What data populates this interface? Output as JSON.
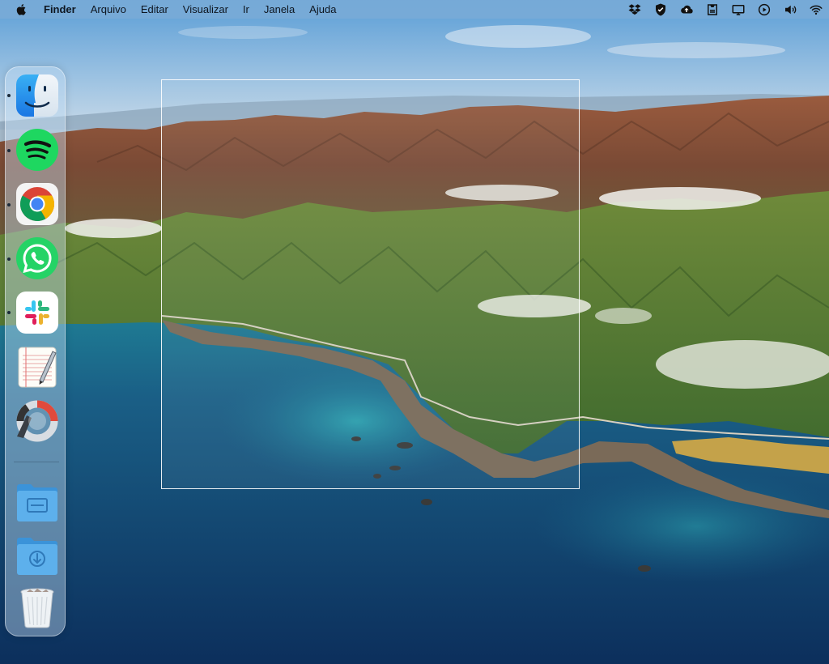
{
  "menubar": {
    "apple_menu_icon": "apple-logo-icon",
    "app_name": "Finder",
    "items": [
      "Arquivo",
      "Editar",
      "Visualizar",
      "Ir",
      "Janela",
      "Ajuda"
    ],
    "status_icons": [
      "dropbox-icon",
      "shield-icon",
      "cloud-upload-icon",
      "clipboard-icon",
      "display-icon",
      "play-circle-icon",
      "volume-icon",
      "wifi-icon"
    ]
  },
  "desktop": {
    "wallpaper": "big-sur-coastline",
    "selection_rectangle": true
  },
  "dock": {
    "apps": [
      {
        "name": "Finder",
        "icon": "finder-icon",
        "running": true
      },
      {
        "name": "Spotify",
        "icon": "spotify-icon",
        "running": true
      },
      {
        "name": "Google Chrome",
        "icon": "chrome-icon",
        "running": true
      },
      {
        "name": "WhatsApp",
        "icon": "whatsapp-icon",
        "running": true
      },
      {
        "name": "Slack",
        "icon": "slack-icon",
        "running": true
      },
      {
        "name": "TextEdit",
        "icon": "textedit-icon",
        "running": false
      },
      {
        "name": "Screen Recorder",
        "icon": "screen-recorder-icon",
        "running": false
      }
    ],
    "folders": [
      {
        "name": "Applications",
        "icon": "applications-folder-icon"
      },
      {
        "name": "Downloads",
        "icon": "downloads-folder-icon"
      }
    ],
    "trash": {
      "name": "Trash",
      "icon": "trash-icon"
    }
  },
  "colors": {
    "menubar_bg": "#78aad7",
    "selection_border": "#ffffff",
    "spotify_green": "#1ed760",
    "whatsapp_green": "#25d366",
    "folder_blue": "#4aa3e6"
  }
}
